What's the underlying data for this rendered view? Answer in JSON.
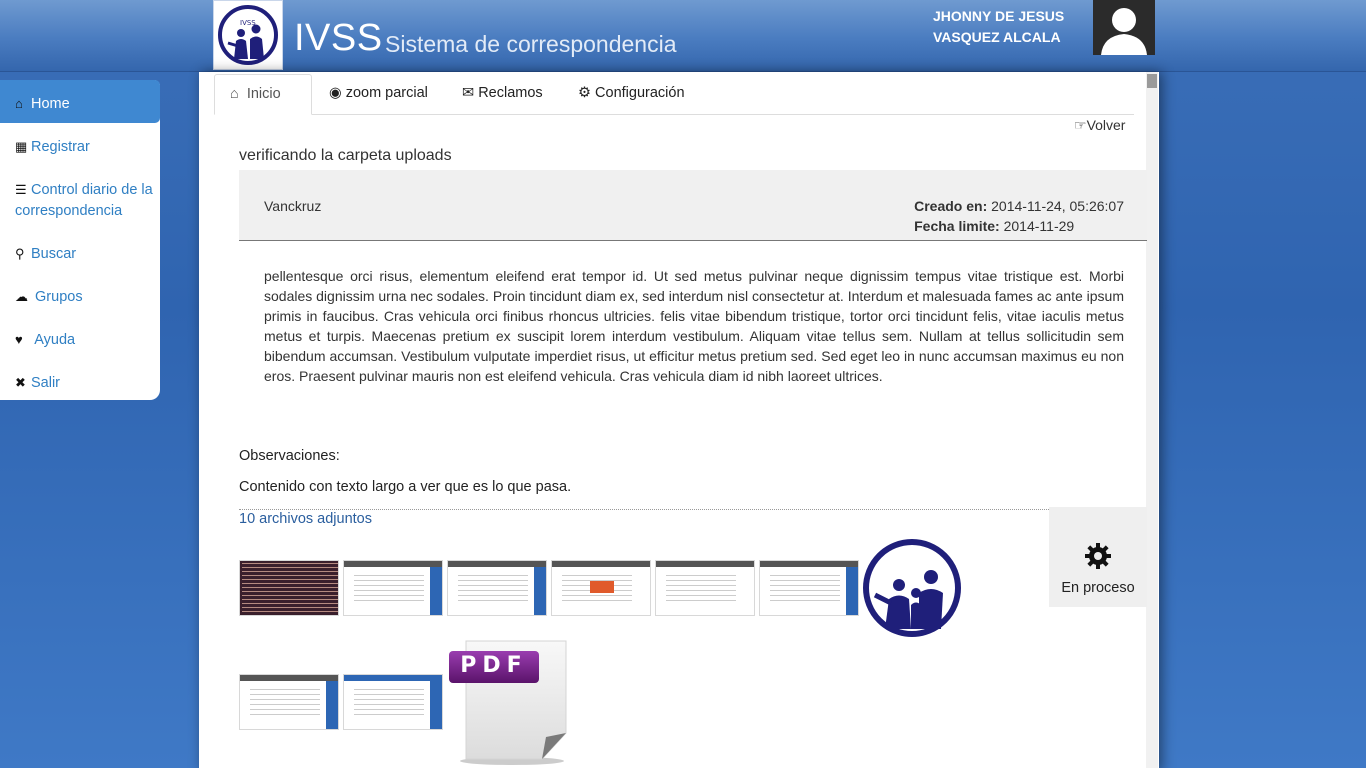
{
  "header": {
    "brand": "IVSS",
    "subtitle": "Sistema de correspondencia",
    "user_line1": "JHONNY DE JESUS",
    "user_line2": "VASQUEZ ALCALA",
    "logo_text": "IVSS"
  },
  "sidebar": {
    "items": [
      {
        "label": "Home",
        "icon": "home-icon"
      },
      {
        "label": "Registrar",
        "icon": "floppy-icon"
      },
      {
        "label": "Control diario de la correspondencia",
        "icon": "list-icon"
      },
      {
        "label": "Buscar",
        "icon": "search-icon"
      },
      {
        "label": "Grupos",
        "icon": "cloud-icon"
      },
      {
        "label": "Ayuda",
        "icon": "heart-icon"
      },
      {
        "label": "Salir",
        "icon": "close-icon"
      }
    ]
  },
  "tabs": [
    {
      "label": "Inicio",
      "icon": "home-icon"
    },
    {
      "label": "zoom parcial",
      "icon": "eye-icon"
    },
    {
      "label": "Reclamos",
      "icon": "envelope-icon"
    },
    {
      "label": "Configuración",
      "icon": "gear-icon"
    }
  ],
  "volver_label": "Volver",
  "document": {
    "subject": "verificando la carpeta uploads",
    "author": "Vanckruz",
    "created_label": "Creado en:",
    "created_value": "2014-11-24, 05:26:07",
    "deadline_label": "Fecha limite:",
    "deadline_value": "2014-11-29",
    "body": "pellentesque orci risus, elementum eleifend erat tempor id. Ut sed metus pulvinar neque dignissim tempus vitae tristique est. Morbi sodales dignissim urna nec sodales. Proin tincidunt diam ex, sed interdum nisl consectetur at. Interdum et malesuada fames ac ante ipsum primis in faucibus. Cras vehicula orci finibus rhoncus ultricies. felis vitae bibendum tristique, tortor orci tincidunt felis, vitae iaculis metus metus et turpis. Maecenas pretium ex suscipit lorem interdum vestibulum. Aliquam vitae tellus sem. Nullam at tellus sollicitudin sem bibendum accumsan. Vestibulum vulputate imperdiet risus, ut efficitur metus pretium sed. Sed eget leo in nunc accumsan maximus eu non eros. Praesent pulvinar mauris non est eleifend vehicula. Cras vehicula diam id nibh laoreet ultrices.",
    "observations_label": "Observaciones:",
    "observations_text": "Contenido con texto largo a ver que es lo que pasa.",
    "attachments_label": "10 archivos adjuntos",
    "pdf_label": "PDF"
  },
  "status": {
    "label": "En proceso",
    "icon": "gear-icon"
  },
  "colors": {
    "header_blue": "#4a7cc0",
    "active_nav": "#3f88d1",
    "link_blue": "#2f7fc3",
    "logo_navy": "#1f1f7a",
    "pdf_purple": "#6a1b7d"
  }
}
